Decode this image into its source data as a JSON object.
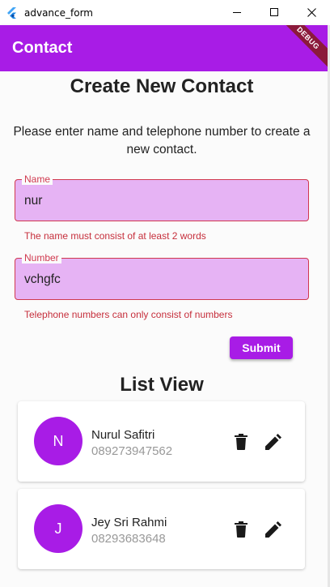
{
  "window": {
    "title": "advance_form"
  },
  "appbar": {
    "title": "Contact",
    "debug_banner": "DEBUG"
  },
  "form": {
    "title": "Create New Contact",
    "instructions": "Please enter name and telephone number to create a new contact.",
    "name_field": {
      "label": "Name",
      "value": "nur",
      "error": "The name must consist of at least 2 words"
    },
    "number_field": {
      "label": "Number",
      "value": "vchgfc",
      "error": "Telephone numbers can only consist of numbers"
    },
    "submit_label": "Submit"
  },
  "list": {
    "title": "List View",
    "contacts": [
      {
        "initial": "N",
        "name": "Nurul Safitri",
        "phone": "089273947562"
      },
      {
        "initial": "J",
        "name": "Jey Sri Rahmi",
        "phone": "08293683648"
      }
    ]
  },
  "colors": {
    "accent": "#a81ce6",
    "field_fill": "#e6b3f4",
    "error": "#d0394f",
    "debug_ribbon": "#8b1a3b"
  },
  "icons": {
    "app": "flutter-logo-icon",
    "minimize": "minimize-icon",
    "maximize": "maximize-icon",
    "close": "close-icon",
    "delete": "trash-icon",
    "edit": "pencil-icon"
  }
}
